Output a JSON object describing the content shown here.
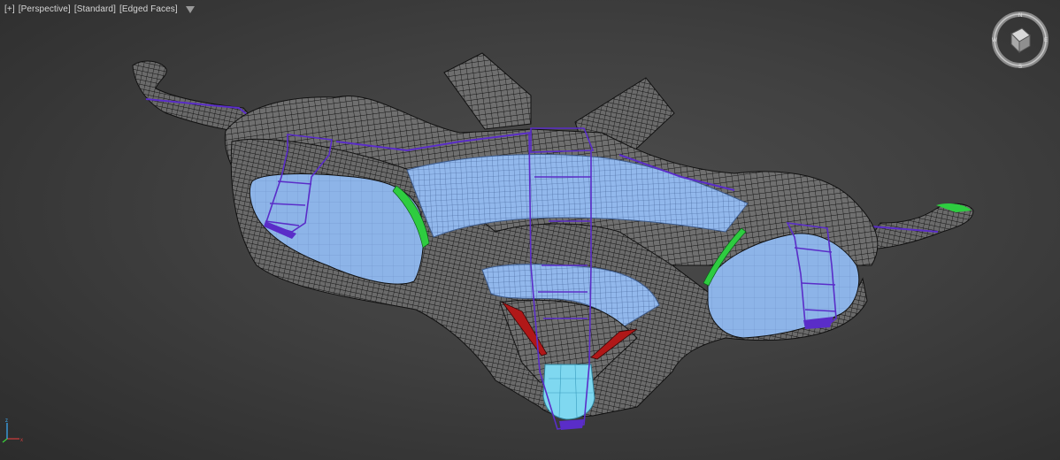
{
  "viewport": {
    "labels": {
      "plus": "[+]",
      "view": "[Perspective]",
      "shading": "[Standard]",
      "display": "[Edged Faces]"
    },
    "filter_icon": "funnel-icon"
  },
  "viewcube": {
    "icon": "viewcube-icon"
  },
  "axis": {
    "icon": "axis-tripod-icon"
  },
  "colors": {
    "background": "#404040",
    "mesh_fill": "#6e6e6e",
    "wire": "#111111",
    "selection_blue": "#8fb6ea",
    "purple_edges": "#5a2dc8",
    "green_strip": "#2ecc40",
    "red_panel": "#b01818",
    "cyan_tip": "#7fd8f0"
  }
}
